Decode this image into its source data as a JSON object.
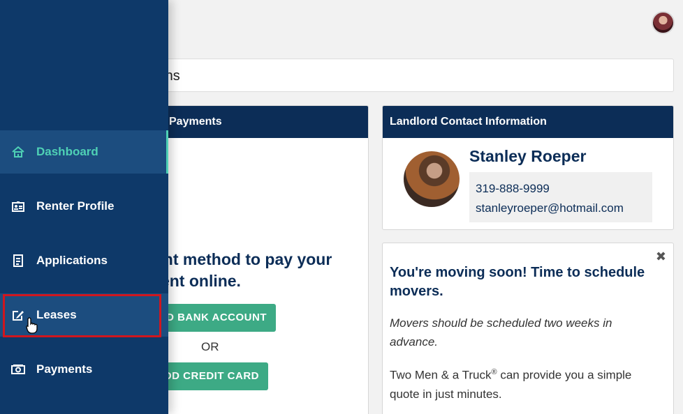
{
  "header": {
    "title_fragment": "ions"
  },
  "payments": {
    "header_label": "Payments",
    "message_line1": "ent method to pay your",
    "message_line2": "rent online.",
    "bank_button": "D BANK ACCOUNT",
    "or_label": "OR",
    "card_button": "DD CREDIT CARD"
  },
  "landlord": {
    "header_label": "Landlord Contact Information",
    "name": "Stanley Roeper",
    "phone": "319-888-9999",
    "email": "stanleyroeper@hotmail.com"
  },
  "movers": {
    "close_label": "✖",
    "title": "You're moving soon! Time to schedule movers.",
    "italic_note": "Movers should be scheduled two weeks in advance.",
    "body_prefix": "Two Men & a Truck",
    "body_sup": "®",
    "body_suffix": " can provide you a simple quote in just minutes."
  },
  "sidebar": {
    "items": [
      {
        "label": "Dashboard",
        "icon": "home-icon",
        "state": "active"
      },
      {
        "label": "Renter Profile",
        "icon": "id-card-icon",
        "state": "normal"
      },
      {
        "label": "Applications",
        "icon": "document-icon",
        "state": "normal"
      },
      {
        "label": "Leases",
        "icon": "edit-icon",
        "state": "hovered"
      },
      {
        "label": "Payments",
        "icon": "money-icon",
        "state": "normal"
      }
    ]
  },
  "colors": {
    "sidebar_bg": "#0e3969",
    "header_bg": "#0c2d57",
    "accent_teal": "#4fd1b5",
    "button_green": "#3daa85",
    "highlight_red": "#d0161e"
  }
}
